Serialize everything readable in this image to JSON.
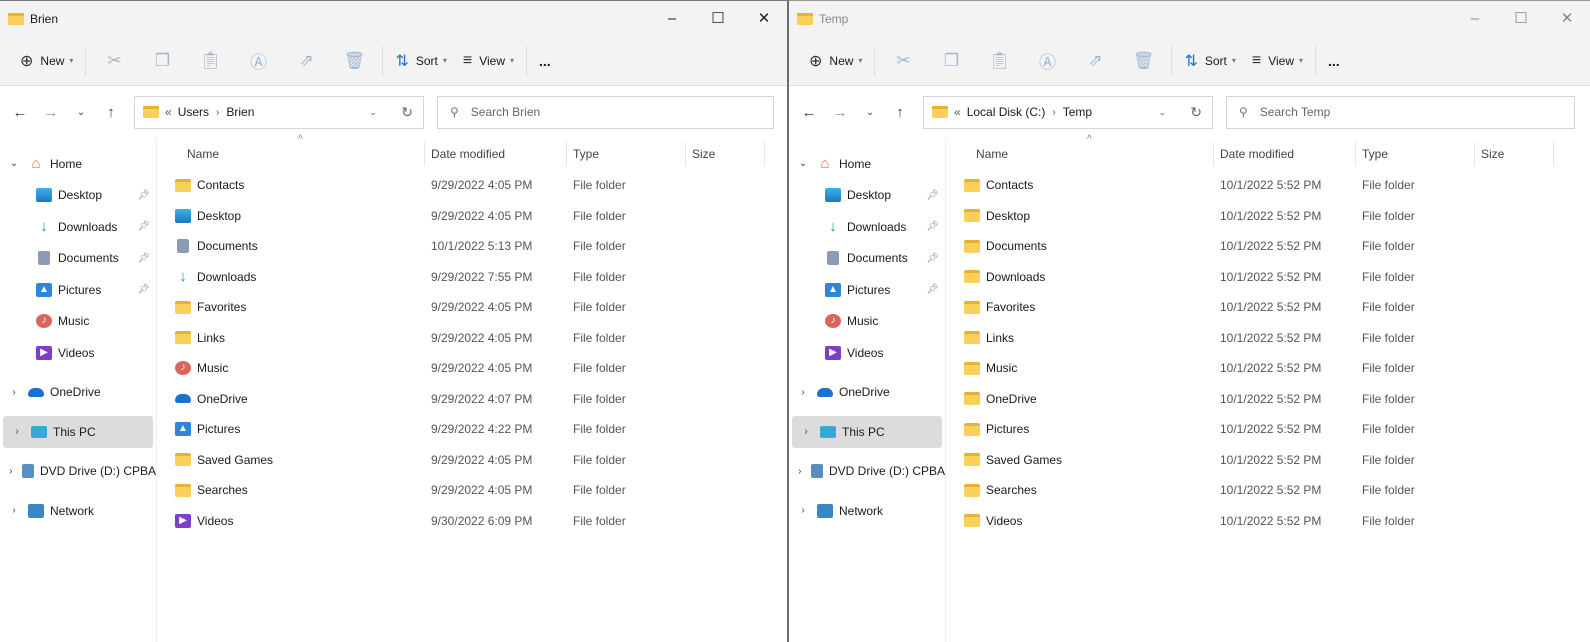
{
  "windows": [
    {
      "title": "Brien",
      "active": true,
      "toolbar": {
        "new": "New",
        "sort": "Sort",
        "view": "View",
        "more": "..."
      },
      "address": {
        "crumbs": [
          "Users",
          "Brien"
        ]
      },
      "search_placeholder": "Search Brien",
      "columns": [
        "Name",
        "Date modified",
        "Type",
        "Size"
      ],
      "files": [
        {
          "name": "Contacts",
          "date": "9/29/2022 4:05 PM",
          "type": "File folder",
          "icon": "folder"
        },
        {
          "name": "Desktop",
          "date": "9/29/2022 4:05 PM",
          "type": "File folder",
          "icon": "desktop"
        },
        {
          "name": "Documents",
          "date": "10/1/2022 5:13 PM",
          "type": "File folder",
          "icon": "documents"
        },
        {
          "name": "Downloads",
          "date": "9/29/2022 7:55 PM",
          "type": "File folder",
          "icon": "downloads"
        },
        {
          "name": "Favorites",
          "date": "9/29/2022 4:05 PM",
          "type": "File folder",
          "icon": "folder"
        },
        {
          "name": "Links",
          "date": "9/29/2022 4:05 PM",
          "type": "File folder",
          "icon": "folder"
        },
        {
          "name": "Music",
          "date": "9/29/2022 4:05 PM",
          "type": "File folder",
          "icon": "music"
        },
        {
          "name": "OneDrive",
          "date": "9/29/2022 4:07 PM",
          "type": "File folder",
          "icon": "onedrive"
        },
        {
          "name": "Pictures",
          "date": "9/29/2022 4:22 PM",
          "type": "File folder",
          "icon": "pictures"
        },
        {
          "name": "Saved Games",
          "date": "9/29/2022 4:05 PM",
          "type": "File folder",
          "icon": "folder"
        },
        {
          "name": "Searches",
          "date": "9/29/2022 4:05 PM",
          "type": "File folder",
          "icon": "folder"
        },
        {
          "name": "Videos",
          "date": "9/30/2022 6:09 PM",
          "type": "File folder",
          "icon": "videos"
        }
      ]
    },
    {
      "title": "Temp",
      "active": false,
      "toolbar": {
        "new": "New",
        "sort": "Sort",
        "view": "View",
        "more": "..."
      },
      "address": {
        "crumbs": [
          "Local Disk (C:)",
          "Temp"
        ]
      },
      "search_placeholder": "Search Temp",
      "columns": [
        "Name",
        "Date modified",
        "Type",
        "Size"
      ],
      "files": [
        {
          "name": "Contacts",
          "date": "10/1/2022 5:52 PM",
          "type": "File folder",
          "icon": "folder"
        },
        {
          "name": "Desktop",
          "date": "10/1/2022 5:52 PM",
          "type": "File folder",
          "icon": "folder"
        },
        {
          "name": "Documents",
          "date": "10/1/2022 5:52 PM",
          "type": "File folder",
          "icon": "folder"
        },
        {
          "name": "Downloads",
          "date": "10/1/2022 5:52 PM",
          "type": "File folder",
          "icon": "folder"
        },
        {
          "name": "Favorites",
          "date": "10/1/2022 5:52 PM",
          "type": "File folder",
          "icon": "folder"
        },
        {
          "name": "Links",
          "date": "10/1/2022 5:52 PM",
          "type": "File folder",
          "icon": "folder"
        },
        {
          "name": "Music",
          "date": "10/1/2022 5:52 PM",
          "type": "File folder",
          "icon": "folder"
        },
        {
          "name": "OneDrive",
          "date": "10/1/2022 5:52 PM",
          "type": "File folder",
          "icon": "folder"
        },
        {
          "name": "Pictures",
          "date": "10/1/2022 5:52 PM",
          "type": "File folder",
          "icon": "folder"
        },
        {
          "name": "Saved Games",
          "date": "10/1/2022 5:52 PM",
          "type": "File folder",
          "icon": "folder"
        },
        {
          "name": "Searches",
          "date": "10/1/2022 5:52 PM",
          "type": "File folder",
          "icon": "folder"
        },
        {
          "name": "Videos",
          "date": "10/1/2022 5:52 PM",
          "type": "File folder",
          "icon": "folder"
        }
      ]
    }
  ],
  "nav_pane": [
    {
      "label": "Home",
      "icon": "home",
      "expand": "open"
    },
    {
      "label": "Desktop",
      "icon": "desktop",
      "sub": true,
      "pinned": true
    },
    {
      "label": "Downloads",
      "icon": "downloads",
      "sub": true,
      "pinned": true
    },
    {
      "label": "Documents",
      "icon": "documents",
      "sub": true,
      "pinned": true
    },
    {
      "label": "Pictures",
      "icon": "pictures",
      "sub": true,
      "pinned": true
    },
    {
      "label": "Music",
      "icon": "music",
      "sub": true
    },
    {
      "label": "Videos",
      "icon": "videos",
      "sub": true
    },
    {
      "label": "OneDrive",
      "icon": "onedrive",
      "expand": "closed",
      "gap": true
    },
    {
      "label": "This PC",
      "icon": "pc",
      "expand": "closed",
      "gap": true,
      "selected": true
    },
    {
      "label": "DVD Drive (D:) CPBA",
      "icon": "dvd",
      "expand": "closed",
      "gap": true
    },
    {
      "label": "Network",
      "icon": "network",
      "expand": "closed",
      "gap": true
    }
  ]
}
